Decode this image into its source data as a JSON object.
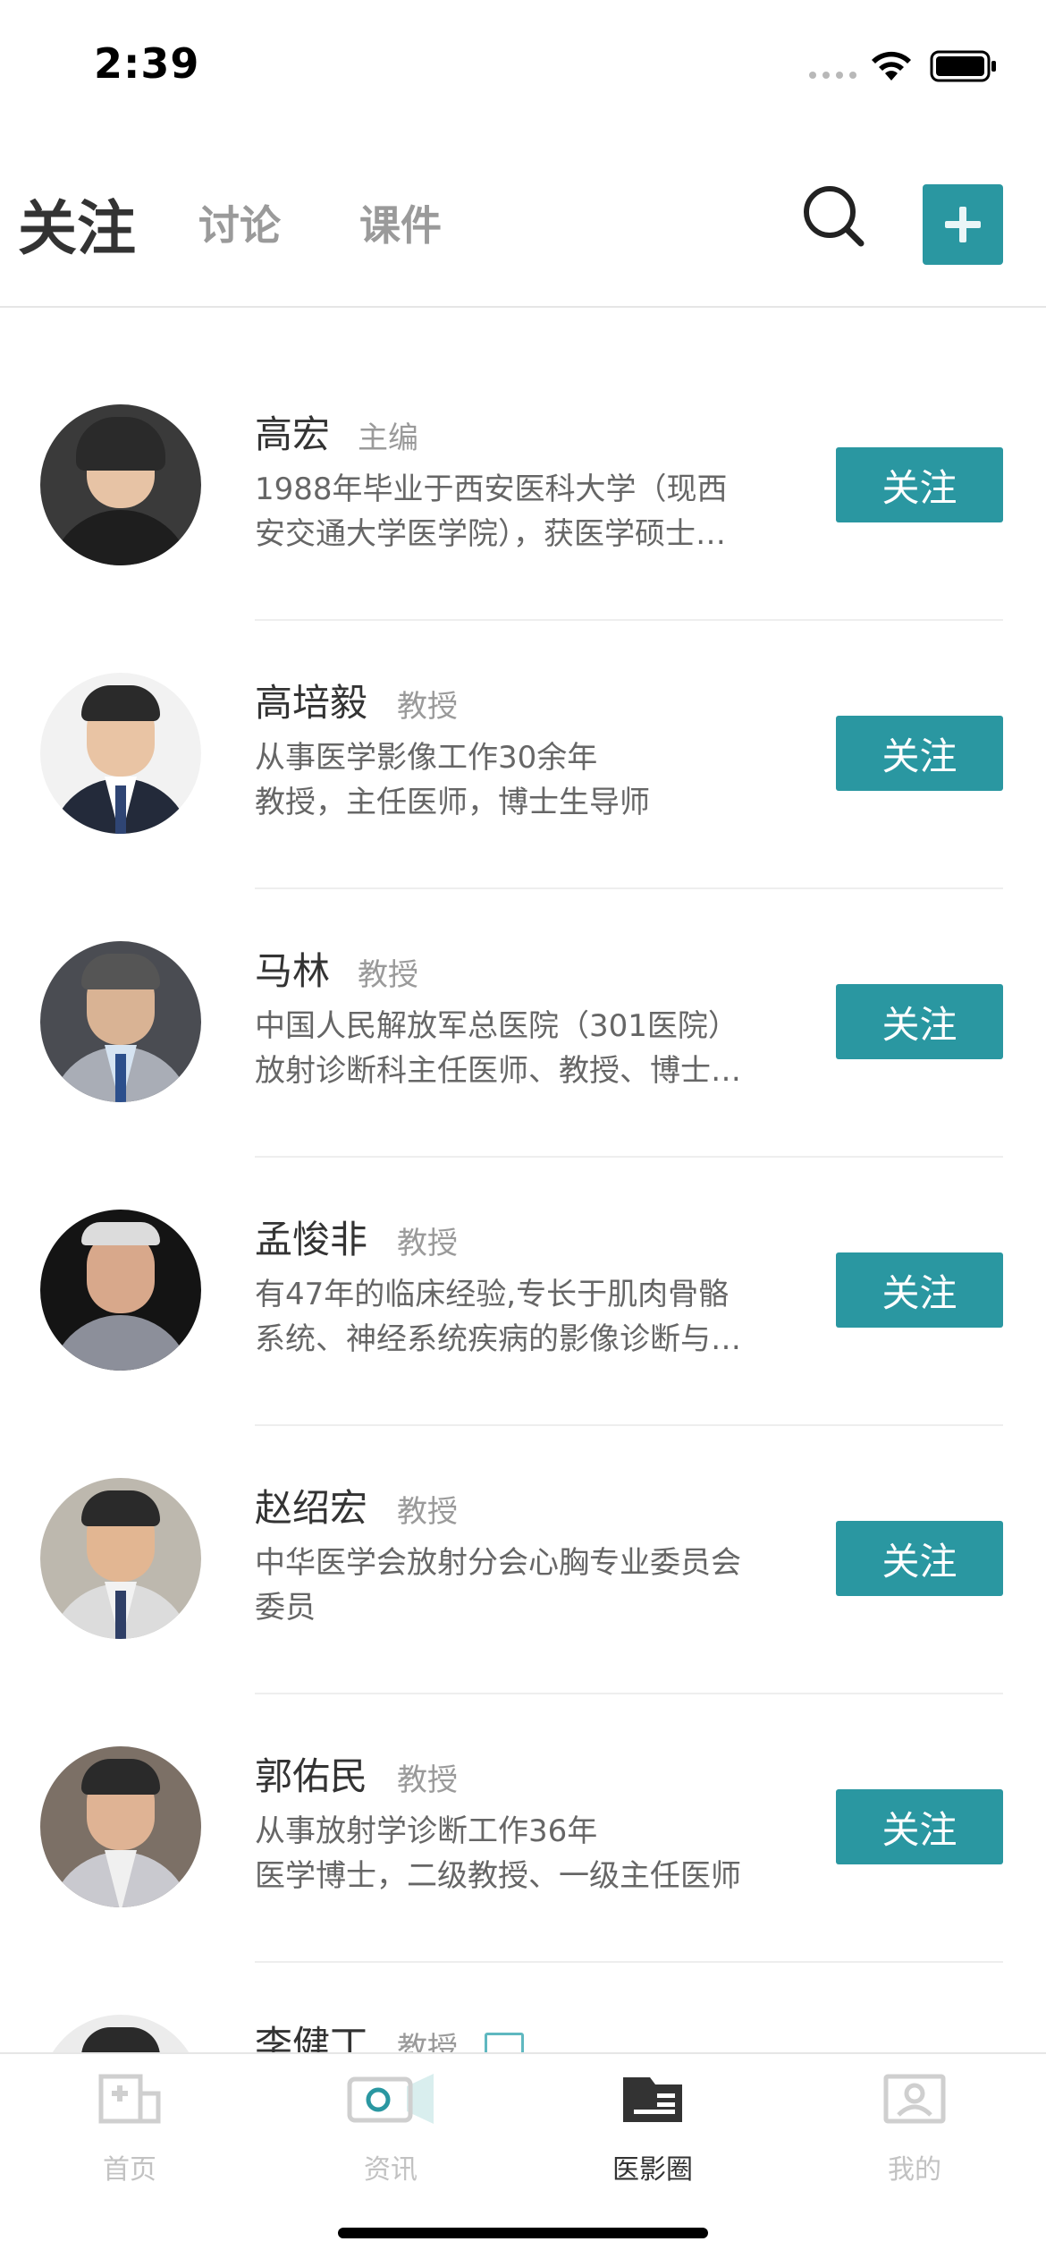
{
  "status_bar": {
    "time": "2:39"
  },
  "header": {
    "tabs": [
      {
        "label": "关注",
        "active": true
      },
      {
        "label": "讨论",
        "active": false
      },
      {
        "label": "课件",
        "active": false
      }
    ],
    "icons": {
      "search": "search-icon",
      "add": "plus-icon"
    }
  },
  "colors": {
    "accent": "#2a97a1",
    "primary_text": "#333333",
    "secondary_text": "#9a9a9a",
    "inactive_tab": "#c2c2c2"
  },
  "follow_label": "关注",
  "experts": [
    {
      "name": "高宏",
      "title": "主编",
      "description": "1988年毕业于西安医科大学（现西安交通大学医学院），获医学硕士学位",
      "suit_color": "#1e1e1e",
      "face_color": "#e7c3a5"
    },
    {
      "name": "高培毅",
      "title": "教授",
      "description": "从事医学影像工作30余年\n教授，主任医师，博士生导师",
      "suit_color": "#232a3a",
      "face_color": "#e9c4a4"
    },
    {
      "name": "马林",
      "title": "教授",
      "description": "中国人民解放军总医院（301医院）放射诊断科主任医师、教授、博士生导师",
      "suit_color": "#a9adb6",
      "face_color": "#d9b394"
    },
    {
      "name": "孟悛非",
      "title": "教授",
      "description": "有47年的临床经验,专长于肌肉骨骼系统、神经系统疾病的影像诊断与研究",
      "suit_color": "#8c8f9a",
      "face_color": "#d8a88b"
    },
    {
      "name": "赵绍宏",
      "title": "教授",
      "description": "中华医学会放射分会心胸专业委员会委员",
      "suit_color": "#dcdcdc",
      "face_color": "#e2b692"
    },
    {
      "name": "郭佑民",
      "title": "教授",
      "description": "从事放射学诊断工作36年\n医学博士，二级教授、一级主任医师",
      "suit_color": "#c9c9cf",
      "face_color": "#dfb394"
    },
    {
      "name": "李健丁",
      "title": "教授",
      "description": "",
      "suit_color": "#2a2a2a",
      "face_color": "#e0b898"
    }
  ],
  "tab_bar": {
    "items": [
      {
        "label": "首页",
        "icon": "home-icon",
        "active": false
      },
      {
        "label": "资讯",
        "icon": "news-video-icon",
        "active": false
      },
      {
        "label": "医影圈",
        "icon": "circle-icon",
        "active": true
      },
      {
        "label": "我的",
        "icon": "profile-icon",
        "active": false
      }
    ]
  }
}
